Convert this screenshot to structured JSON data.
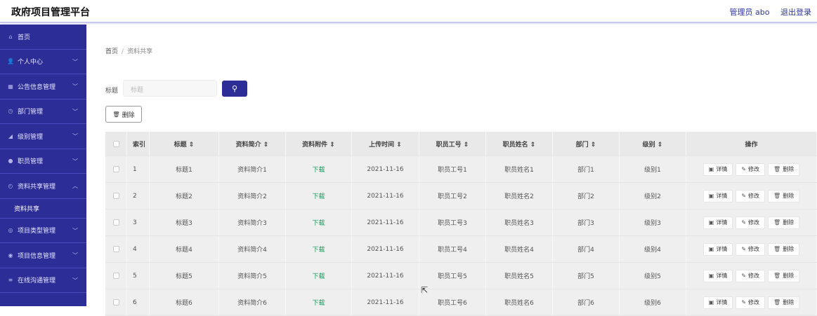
{
  "header": {
    "brand": "政府项目管理平台",
    "user": "管理员 abo",
    "logout": "退出登录"
  },
  "sidebar": {
    "items": [
      {
        "label": "首页",
        "icon": "home-icon",
        "glyph": "⌂",
        "has_chevron": false
      },
      {
        "label": "个人中心",
        "icon": "user-icon",
        "glyph": "👤",
        "has_chevron": true
      },
      {
        "label": "公告信息管理",
        "icon": "notice-icon",
        "glyph": "▦",
        "has_chevron": true
      },
      {
        "label": "部门管理",
        "icon": "clock-icon",
        "glyph": "◷",
        "has_chevron": true
      },
      {
        "label": "级别管理",
        "icon": "level-icon",
        "glyph": "◢",
        "has_chevron": true
      },
      {
        "label": "职员管理",
        "icon": "staff-icon",
        "glyph": "●",
        "has_chevron": true
      },
      {
        "label": "资料共享管理",
        "icon": "share-icon",
        "glyph": "◴",
        "has_chevron": true,
        "expanded": true
      },
      {
        "label": "项目类型管理",
        "icon": "type-icon",
        "glyph": "◎",
        "has_chevron": true
      },
      {
        "label": "项目信息管理",
        "icon": "info-icon",
        "glyph": "◉",
        "has_chevron": true
      },
      {
        "label": "在线沟通管理",
        "icon": "chat-icon",
        "glyph": "≡",
        "has_chevron": true
      }
    ],
    "submenu_label": "资料共享"
  },
  "breadcrumb": {
    "home": "首页",
    "sep": "/",
    "current": "资料共享"
  },
  "search": {
    "label": "标题",
    "placeholder": "标题",
    "button_icon": "search-icon",
    "button_glyph": "⚲"
  },
  "toolbar": {
    "delete_label": "删除",
    "delete_icon": "trash-icon",
    "delete_glyph": "🗑"
  },
  "table": {
    "headers": {
      "index": "索引",
      "title": "标题 ⇕",
      "intro": "资料简介 ⇕",
      "file": "资料附件 ⇕",
      "time": "上传时间 ⇕",
      "no": "职员工号 ⇕",
      "name": "职员姓名 ⇕",
      "dept": "部门 ⇕",
      "level": "级别 ⇕",
      "ops": "操作"
    },
    "rows": [
      {
        "index": "1",
        "title": "标题1",
        "intro": "资料简介1",
        "file": "下载",
        "time": "2021-11-16",
        "no": "职员工号1",
        "name": "职员姓名1",
        "dept": "部门1",
        "level": "级别1"
      },
      {
        "index": "2",
        "title": "标题2",
        "intro": "资料简介2",
        "file": "下载",
        "time": "2021-11-16",
        "no": "职员工号2",
        "name": "职员姓名2",
        "dept": "部门2",
        "level": "级别2"
      },
      {
        "index": "3",
        "title": "标题3",
        "intro": "资料简介3",
        "file": "下载",
        "time": "2021-11-16",
        "no": "职员工号3",
        "name": "职员姓名3",
        "dept": "部门3",
        "level": "级别3"
      },
      {
        "index": "4",
        "title": "标题4",
        "intro": "资料简介4",
        "file": "下载",
        "time": "2021-11-16",
        "no": "职员工号4",
        "name": "职员姓名4",
        "dept": "部门4",
        "level": "级别4"
      },
      {
        "index": "5",
        "title": "标题5",
        "intro": "资料简介5",
        "file": "下载",
        "time": "2021-11-16",
        "no": "职员工号5",
        "name": "职员姓名5",
        "dept": "部门5",
        "level": "级别5"
      },
      {
        "index": "6",
        "title": "标题6",
        "intro": "资料简介6",
        "file": "下载",
        "time": "2021-11-16",
        "no": "职员工号6",
        "name": "职员姓名6",
        "dept": "部门6",
        "level": "级别6"
      }
    ],
    "ops": {
      "detail": "详情",
      "detail_icon": "detail-icon",
      "detail_glyph": "▣",
      "edit": "修改",
      "edit_icon": "edit-icon",
      "edit_glyph": "✎",
      "delete": "删除",
      "delete_icon": "trash-icon",
      "delete_glyph": "🗑"
    }
  },
  "colors": {
    "primary": "#2d2d98",
    "download": "#1a9a5a"
  }
}
